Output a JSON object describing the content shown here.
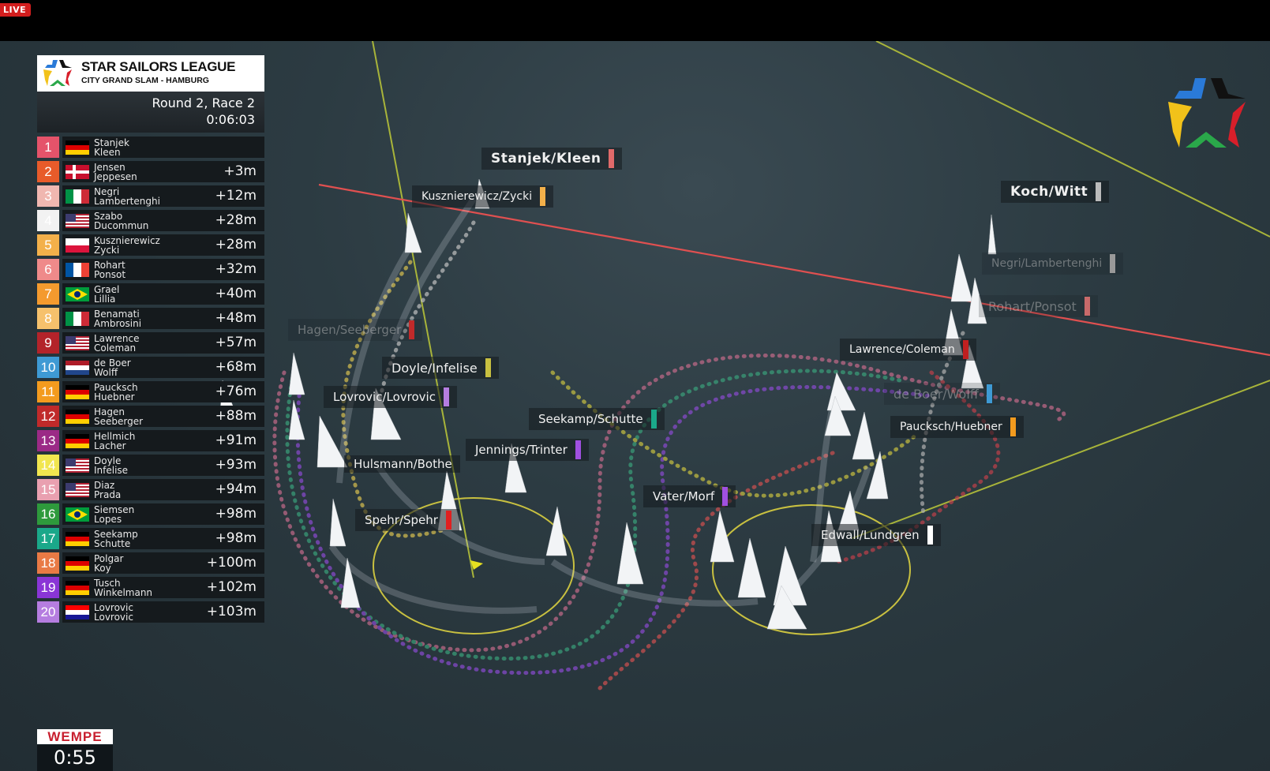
{
  "live_badge": "LIVE",
  "header": {
    "league_title": "STAR SAILORS LEAGUE",
    "league_subtitle": "CITY GRAND SLAM - HAMBURG",
    "race": "Round 2, Race 2",
    "elapsed": "0:06:03"
  },
  "colors": {
    "start_line": "#e05050",
    "course_lines": "#a8b43a",
    "mark_circle": "#c8c040",
    "sponsor_red": "#c8202f"
  },
  "leaderboard": [
    {
      "pos": "1",
      "color": "#e5536a",
      "flag": "de",
      "names": [
        "Stanjek",
        "Kleen"
      ],
      "gap": ""
    },
    {
      "pos": "2",
      "color": "#e85b2a",
      "flag": "dk",
      "names": [
        "Jensen",
        "Jeppesen"
      ],
      "gap": "+3m"
    },
    {
      "pos": "3",
      "color": "#f0b7b0",
      "flag": "it",
      "names": [
        "Negri",
        "Lambertenghi"
      ],
      "gap": "+12m"
    },
    {
      "pos": "4",
      "color": "#f2f2f2",
      "flag": "us",
      "names": [
        "Szabo",
        "Ducommun"
      ],
      "gap": "+28m"
    },
    {
      "pos": "5",
      "color": "#f3b04a",
      "flag": "pl",
      "names": [
        "Kusznierewicz",
        "Zycki"
      ],
      "gap": "+28m"
    },
    {
      "pos": "6",
      "color": "#ef8a8a",
      "flag": "fr",
      "names": [
        "Rohart",
        "Ponsot"
      ],
      "gap": "+32m"
    },
    {
      "pos": "7",
      "color": "#f49a2e",
      "flag": "br",
      "names": [
        "Grael",
        "Lillia"
      ],
      "gap": "+40m"
    },
    {
      "pos": "8",
      "color": "#f6c16c",
      "flag": "it",
      "names": [
        "Benamati",
        "Ambrosini"
      ],
      "gap": "+48m"
    },
    {
      "pos": "9",
      "color": "#b3232a",
      "flag": "us",
      "names": [
        "Lawrence",
        "Coleman"
      ],
      "gap": "+57m"
    },
    {
      "pos": "10",
      "color": "#3e9ad4",
      "flag": "nl",
      "names": [
        "de Boer",
        "Wolff"
      ],
      "gap": "+68m"
    },
    {
      "pos": "11",
      "color": "#f39b1e",
      "flag": "de",
      "names": [
        "Paucksch",
        "Huebner"
      ],
      "gap": "+76m"
    },
    {
      "pos": "12",
      "color": "#c02a2a",
      "flag": "de",
      "names": [
        "Hagen",
        "Seeberger"
      ],
      "gap": "+88m"
    },
    {
      "pos": "13",
      "color": "#9b2a86",
      "flag": "de",
      "names": [
        "Hellmich",
        "Lacher"
      ],
      "gap": "+91m"
    },
    {
      "pos": "14",
      "color": "#f1e64f",
      "flag": "us",
      "names": [
        "Doyle",
        "Infelise"
      ],
      "gap": "+93m"
    },
    {
      "pos": "15",
      "color": "#e9a0b0",
      "flag": "us",
      "names": [
        "Diaz",
        "Prada"
      ],
      "gap": "+94m"
    },
    {
      "pos": "16",
      "color": "#2e9a3c",
      "flag": "br",
      "names": [
        "Siemsen",
        "Lopes"
      ],
      "gap": "+98m"
    },
    {
      "pos": "17",
      "color": "#1aa88a",
      "flag": "de",
      "names": [
        "Seekamp",
        "Schutte"
      ],
      "gap": "+98m"
    },
    {
      "pos": "18",
      "color": "#e97a45",
      "flag": "de",
      "names": [
        "Polgar",
        "Koy"
      ],
      "gap": "+100m"
    },
    {
      "pos": "19",
      "color": "#8a35d6",
      "flag": "de",
      "names": [
        "Tusch",
        "Winkelmann"
      ],
      "gap": "+102m"
    },
    {
      "pos": "20",
      "color": "#b57de0",
      "flag": "hr",
      "names": [
        "Lovrovic",
        "Lovrovic"
      ],
      "gap": "+103m"
    }
  ],
  "boat_labels": [
    {
      "text": "Stanjek/Kleen",
      "tab": "#e06a6a",
      "style": "big"
    },
    {
      "text": "Kusznierewicz/Zycki",
      "tab": "#f3b04a",
      "style": "normal"
    },
    {
      "text": "Koch/Witt",
      "tab": "#bbbbbb",
      "style": "big"
    },
    {
      "text": "Negri/Lambertenghi",
      "tab": "#999999",
      "style": "dim"
    },
    {
      "text": "Rohart/Ponsot",
      "tab": "#c86a6a",
      "style": "dim"
    },
    {
      "text": "Hagen/Seeberger",
      "tab": "#c02a2a",
      "style": "dim"
    },
    {
      "text": "Lawrence/Coleman",
      "tab": "#c02020",
      "style": "normal"
    },
    {
      "text": "Doyle/Infelise",
      "tab": "#c8c040",
      "style": "normal"
    },
    {
      "text": "de Boer/Wolff",
      "tab": "#3e9ad4",
      "style": "dim"
    },
    {
      "text": "Lovrovic/Lovrovic",
      "tab": "#b57de0",
      "style": "normal"
    },
    {
      "text": "Seekamp/Schutte",
      "tab": "#1aa88a",
      "style": "normal"
    },
    {
      "text": "Paucksch/Huebner",
      "tab": "#f39b1e",
      "style": "normal"
    },
    {
      "text": "Jennings/Trinter",
      "tab": "#a050e0",
      "style": "normal"
    },
    {
      "text": "Hulsmann/Bothe",
      "tab": "",
      "style": "normal"
    },
    {
      "text": "Vater/Morf",
      "tab": "#a050e0",
      "style": "normal"
    },
    {
      "text": "Spehr/Spehr",
      "tab": "#e02020",
      "style": "normal"
    },
    {
      "text": "Edwall/Lundgren",
      "tab": "#ffffff",
      "style": "normal"
    }
  ],
  "sponsor": "WEMPE",
  "countdown": "0:55"
}
